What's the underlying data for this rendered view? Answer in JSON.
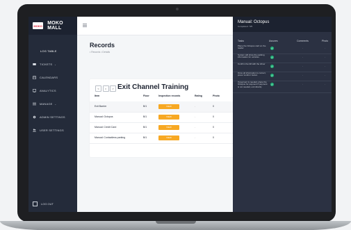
{
  "app": {
    "brand_logo_text": "MOKO",
    "brand_name": "MOKO MALL"
  },
  "sidebar": {
    "items": [
      {
        "label": "LOG TABLE",
        "icon": ""
      },
      {
        "label": "TICKETS",
        "icon": "ticket-icon"
      },
      {
        "label": "CALENDARS",
        "icon": "calendar-icon"
      },
      {
        "label": "ANALYTICS",
        "icon": "analytics-icon"
      },
      {
        "label": "MANAGE",
        "icon": "list-icon"
      },
      {
        "label": "ADMIN SETTINGS",
        "icon": "gear-icon"
      },
      {
        "label": "USER SETTINGS",
        "icon": "users-icon"
      }
    ],
    "logout_label": "LOG OUT"
  },
  "main": {
    "title": "Records",
    "breadcrumb": "• Records  • Details",
    "card": {
      "title": "Exit Channel Training",
      "pager": [
        "<",
        "=",
        ">"
      ],
      "columns": [
        "Item",
        "Floor",
        "Inspection records",
        "Rating",
        "Photo"
      ],
      "rows": [
        {
          "item": "Exit Barrier",
          "floor": "B/1",
          "action": "VIEW",
          "rating": "-",
          "photo": "0"
        },
        {
          "item": "Manual: Octopus",
          "floor": "B/1",
          "action": "VIEW",
          "rating": "-",
          "photo": "0"
        },
        {
          "item": "Manual: Credit Card",
          "floor": "B/1",
          "action": "VIEW",
          "rating": "-",
          "photo": "0"
        },
        {
          "item": "Manual: Contactless parking",
          "floor": "B/1",
          "action": "VIEW",
          "rating": "-",
          "photo": "0"
        }
      ]
    }
  },
  "panel": {
    "title": "Manual: Octopus",
    "subtitle": "Completed : 5/5",
    "columns": [
      "Tasks",
      "Assures",
      "Comments",
      "Photo"
    ],
    "rows": [
      {
        "task": "Place the Octopus card on the reader",
        "comments": "-",
        "photo": "-"
      },
      {
        "task": "System will show the parking information for vehicles",
        "comments": "-",
        "photo": "-"
      },
      {
        "task": "Confirm the bill with the driver",
        "comments": "-",
        "photo": "-"
      },
      {
        "task": "Once all information is correct, press 'confirm' button",
        "comments": "-",
        "photo": "-"
      },
      {
        "task": "If payment is needed, place the Octopus for payment if payment is not needed, exit directly",
        "comments": "-",
        "photo": "-"
      }
    ]
  },
  "colors": {
    "sidebar": "#242b3a",
    "accent_orange": "#f7a823",
    "check_green": "#25b37a",
    "panel": "#2b3142"
  }
}
